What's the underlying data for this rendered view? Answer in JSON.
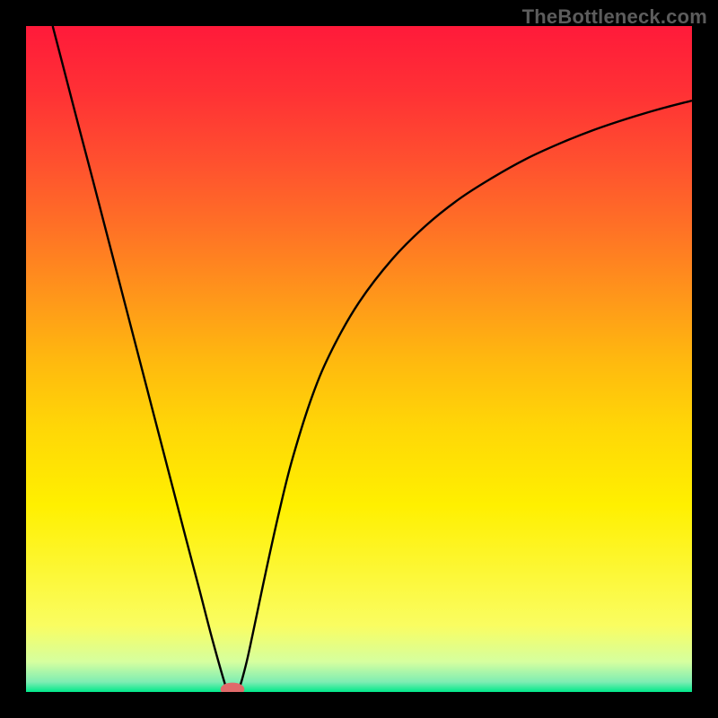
{
  "watermark": "TheBottleneck.com",
  "chart_data": {
    "type": "line",
    "title": "",
    "xlabel": "",
    "ylabel": "",
    "xlim": [
      0,
      1
    ],
    "ylim": [
      0,
      1
    ],
    "background": {
      "type": "vertical-gradient",
      "stops": [
        {
          "offset": 0.0,
          "color": "#ff1a3a"
        },
        {
          "offset": 0.1,
          "color": "#ff3135"
        },
        {
          "offset": 0.2,
          "color": "#ff4f2f"
        },
        {
          "offset": 0.3,
          "color": "#ff7026"
        },
        {
          "offset": 0.4,
          "color": "#ff941b"
        },
        {
          "offset": 0.5,
          "color": "#ffb80f"
        },
        {
          "offset": 0.6,
          "color": "#ffd607"
        },
        {
          "offset": 0.72,
          "color": "#fff000"
        },
        {
          "offset": 0.9,
          "color": "#fafd61"
        },
        {
          "offset": 0.955,
          "color": "#d5ff9f"
        },
        {
          "offset": 0.985,
          "color": "#7eedb3"
        },
        {
          "offset": 1.0,
          "color": "#00e88a"
        }
      ]
    },
    "series": [
      {
        "name": "bottleneck-curve",
        "color": "#000000",
        "x": [
          0.04,
          0.06,
          0.08,
          0.1,
          0.12,
          0.14,
          0.16,
          0.18,
          0.2,
          0.22,
          0.24,
          0.26,
          0.28,
          0.3,
          0.305,
          0.31,
          0.315,
          0.32,
          0.33,
          0.34,
          0.36,
          0.38,
          0.4,
          0.43,
          0.46,
          0.5,
          0.55,
          0.6,
          0.65,
          0.7,
          0.75,
          0.8,
          0.85,
          0.9,
          0.95,
          1.0
        ],
        "y": [
          1.0,
          0.923,
          0.846,
          0.77,
          0.693,
          0.616,
          0.539,
          0.462,
          0.385,
          0.308,
          0.231,
          0.155,
          0.078,
          0.008,
          0.0,
          0.0,
          0.0,
          0.005,
          0.04,
          0.085,
          0.18,
          0.27,
          0.35,
          0.445,
          0.515,
          0.585,
          0.65,
          0.7,
          0.74,
          0.772,
          0.8,
          0.823,
          0.843,
          0.86,
          0.875,
          0.888
        ]
      }
    ],
    "marker": {
      "name": "optimal-point",
      "x": 0.31,
      "y": 0.004,
      "rx": 0.018,
      "ry": 0.01,
      "color": "#e06a6a"
    }
  }
}
